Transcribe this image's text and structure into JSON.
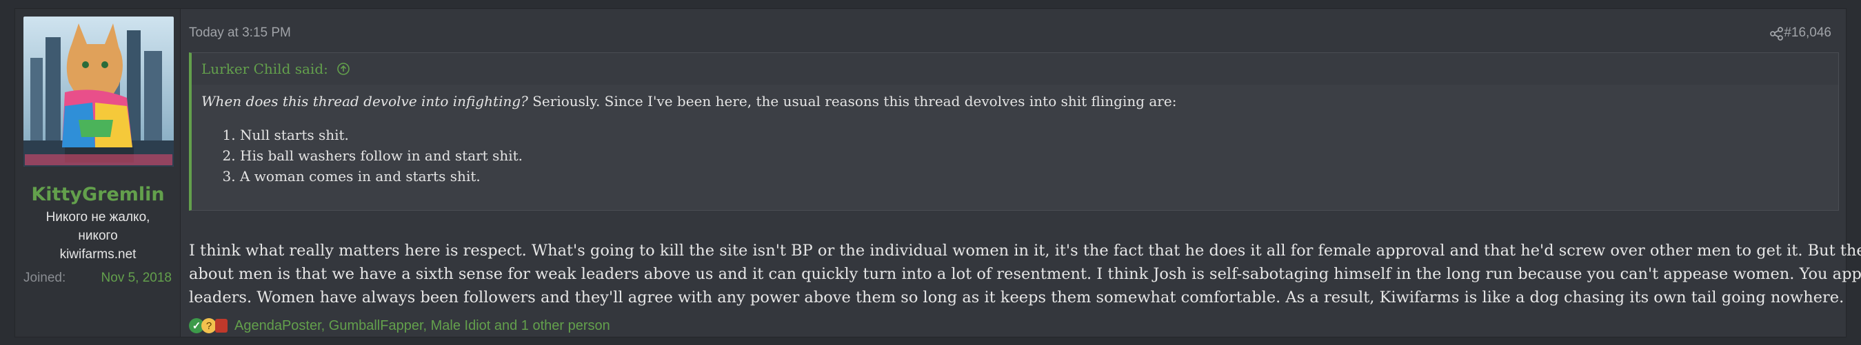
{
  "post": {
    "timestamp": "Today at 3:15 PM",
    "post_number": "#16,046",
    "share_icon": "share-icon"
  },
  "user": {
    "username": "KittyGremlin",
    "title_line1": "Никого не жалко,",
    "title_line2": "никого",
    "title_line3": "kiwifarms.net",
    "joined_label": "Joined:",
    "joined_value": "Nov 5, 2018",
    "username_color": "#63a04c"
  },
  "quote": {
    "author": "Lurker Child said:",
    "intro_italic": "When does this thread devolve into infighting?",
    "intro_rest": " Seriously. Since I've been here, the usual reasons this thread devolves into shit flinging are:",
    "items": [
      "Null starts shit.",
      "His ball washers follow in and start shit.",
      "A woman comes in and starts shit."
    ],
    "accent_color": "#63a04c"
  },
  "body": {
    "line1": "I think what really matters here is respect. What's going to kill the site isn't BP or the individual women in it, it's the fact that he does it all for female approval and that he'd screw over other men to get it. But the thing",
    "line2": "about men is that we have a sixth sense for weak leaders above us and it can quickly turn into a lot of resentment. I think Josh is self-sabotaging himself in the long run because you can't appease women. You appease",
    "line3": "leaders. Women have always been followers and they'll agree with any power above them so long as it keeps them somewhat comfortable. As a result, Kiwifarms is like a dog chasing its own tail going nowhere."
  },
  "reactions": {
    "icons": [
      "check-reaction-icon",
      "thinking-reaction-icon",
      "flag-reaction-icon"
    ],
    "text": "AgendaPoster, GumballFapper, Male Idiot and 1 other person"
  }
}
